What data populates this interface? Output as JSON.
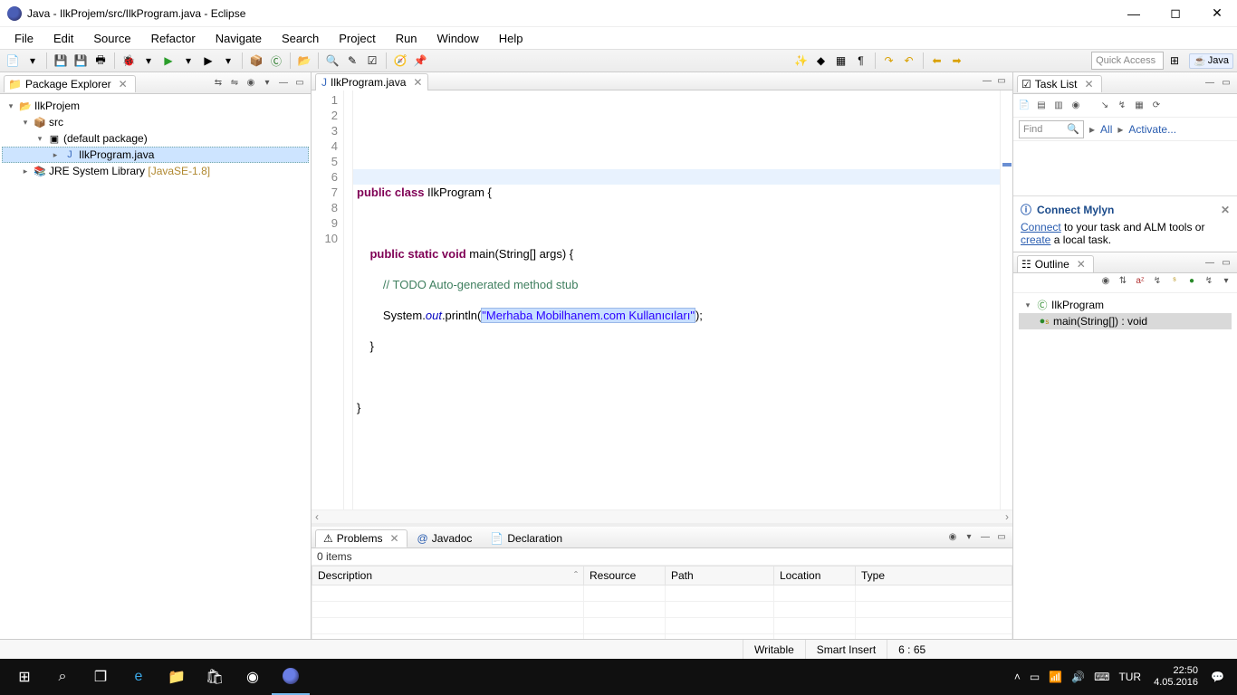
{
  "window": {
    "title": "Java - IlkProjem/src/IlkProgram.java - Eclipse"
  },
  "menu": [
    "File",
    "Edit",
    "Source",
    "Refactor",
    "Navigate",
    "Search",
    "Project",
    "Run",
    "Window",
    "Help"
  ],
  "quick_access": "Quick Access",
  "perspective": "Java",
  "package_explorer": {
    "title": "Package Explorer",
    "project": "IlkProjem",
    "src": "src",
    "pkg": "(default package)",
    "file": "IlkProgram.java",
    "jre": "JRE System Library",
    "jre_ver": "[JavaSE-1.8]"
  },
  "editor": {
    "tab": "IlkProgram.java",
    "lines": [
      "1",
      "2",
      "3",
      "4",
      "5",
      "6",
      "7",
      "8",
      "9",
      "10"
    ],
    "code": {
      "l2a": "public",
      "l2b": " class",
      "l2c": " IlkProgram {",
      "l4a": "    public",
      "l4b": " static",
      "l4c": " void",
      "l4d": " main(String[] args) {",
      "l5a": "        // TODO Auto-generated method stub",
      "l6a": "        System.",
      "l6b": "out",
      "l6c": ".println(",
      "l6s": "\"Merhaba Mobilhanem.com Kullanıcıları\"",
      "l6d": ");",
      "l7": "    }",
      "l9": "}"
    }
  },
  "problems": {
    "tabs": [
      "Problems",
      "Javadoc",
      "Declaration"
    ],
    "count": "0 items",
    "cols": [
      "Description",
      "Resource",
      "Path",
      "Location",
      "Type"
    ]
  },
  "tasklist": {
    "title": "Task List",
    "find": "Find",
    "all": "All",
    "activate": "Activate..."
  },
  "mylyn": {
    "title": "Connect Mylyn",
    "connect": "Connect",
    "text1": " to your task and ALM tools or ",
    "create": "create",
    "text2": " a local task."
  },
  "outline": {
    "title": "Outline",
    "class": "IlkProgram",
    "method": "main(String[]) : void"
  },
  "status": {
    "writable": "Writable",
    "insert": "Smart Insert",
    "pos": "6 : 65"
  },
  "tray": {
    "lang": "TUR",
    "time": "22:50",
    "date": "4.05.2016"
  }
}
